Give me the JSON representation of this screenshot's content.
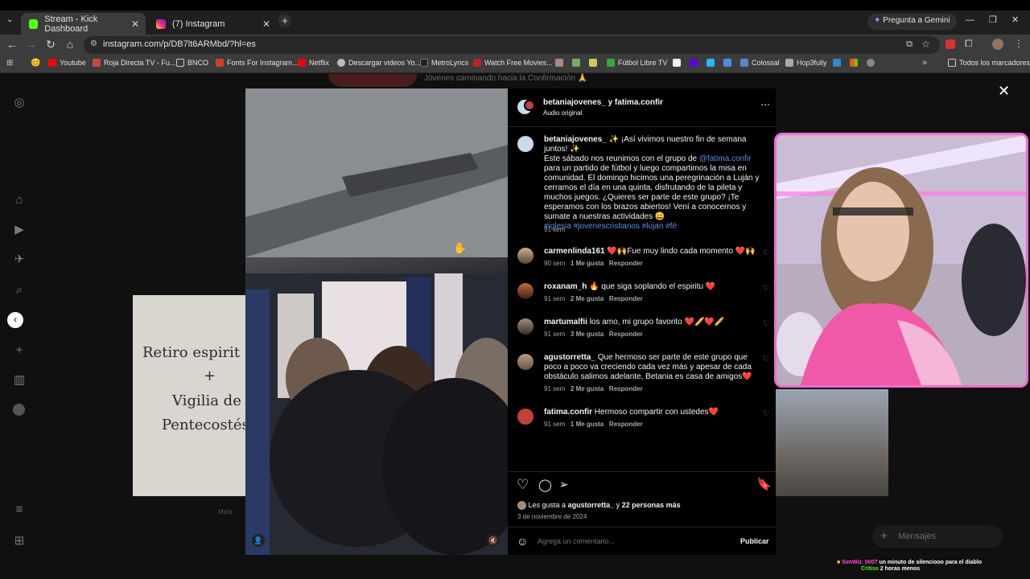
{
  "browser": {
    "tabs": [
      {
        "title": "Stream - Kick Dashboard",
        "active": true
      },
      {
        "title": "(7) Instagram",
        "active": false
      }
    ],
    "gemini_label": "Pregunta a Gemini",
    "url": "instagram.com/p/DB7lt6ARMbd/?hl=es",
    "bookmarks": [
      "Youtube",
      "Roja Directa TV - Fu...",
      "BNCO",
      "Fonts For Instagram...",
      "Netflix",
      "Descargar videos Yo...",
      "MetroLyrics",
      "Watch Free Movies...",
      "Fútbol Libre TV",
      "Colossal",
      "Hop3fully",
      "Todos los marcadores"
    ]
  },
  "background": {
    "card_lines": [
      "Retiro espirit",
      "+",
      "Vigilia de",
      "Pentecostés"
    ],
    "top_line": "Jóvenes caminando hacia la Confirmación 🙏",
    "footer_meta": "Meta",
    "messages_label": "Mensajes"
  },
  "post": {
    "header_user": "betaniajovenes_ y fatima.confir",
    "header_audio": "Audio original",
    "caption_user": "betaniajovenes_",
    "caption_line1": "✨ ¡Así vivimos nuestro fin de semana juntos! ✨",
    "caption_body_pre": "Este sábado nos reunimos con el grupo de ",
    "caption_mention": "@fatima.confir",
    "caption_body_post": " para un partido de fútbol y luego compartimos la misa en comunidad. El domingo hicimos una peregrinación a Luján y cerramos el día en una quinta, disfrutando de la pileta y muchos juegos. ¿Quieres ser parte de este grupo? ¡Te esperamos con los brazos abiertos! Vení a conocernos y sumate a nuestras actividades 😄",
    "caption_tags": "#iglesia #jovenescristianos #lujan #fé",
    "caption_time": "91 sem",
    "comments": [
      {
        "user": "carmenlinda161",
        "text": "❤️🙌Fue muy lindo cada momento ❤️🙌",
        "time": "90 sem",
        "likes": "1 Me gusta",
        "reply": "Responder"
      },
      {
        "user": "roxanam_h",
        "text": "🔥 que siga soplando el espiritu ❤️",
        "time": "91 sem",
        "likes": "2 Me gusta",
        "reply": "Responder"
      },
      {
        "user": "martumalfii",
        "text": "los amo, mi grupo favorito ❤️🥖❤️🥖",
        "time": "91 sem",
        "likes": "3 Me gusta",
        "reply": "Responder"
      },
      {
        "user": "agustorretta_",
        "text": "Que hermoso ser parte de este grupo que poco a poco va creciendo cada vez más y apesar de cada obstáculo salimos adelante, Betania es casa de amigos❤️",
        "time": "91 sem",
        "likes": "2 Me gusta",
        "reply": "Responder"
      },
      {
        "user": "fatima.confir",
        "text": "Hermoso compartir con ustedes❤️",
        "time": "91 sem",
        "likes": "1 Me gusta",
        "reply": "Responder"
      }
    ],
    "likes_pre": "Les gusta a ",
    "likes_user": "agustorretta_",
    "likes_post": " y ",
    "likes_more": "22 personas más",
    "date": "3 de noviembre de 2024",
    "comment_placeholder": "Agrega un comentario...",
    "publish_label": "Publicar"
  },
  "stream_chat": {
    "line1_user": "SimWiz_0007",
    "line1_text": "un minuto de silenciooo para el diablo",
    "line2_user": "Critiss",
    "line2_text": "2 horas menos"
  },
  "colors": {
    "accent_link": "#5b8fe8",
    "cam_border": "#f06ad0",
    "ig_black": "#000000"
  }
}
